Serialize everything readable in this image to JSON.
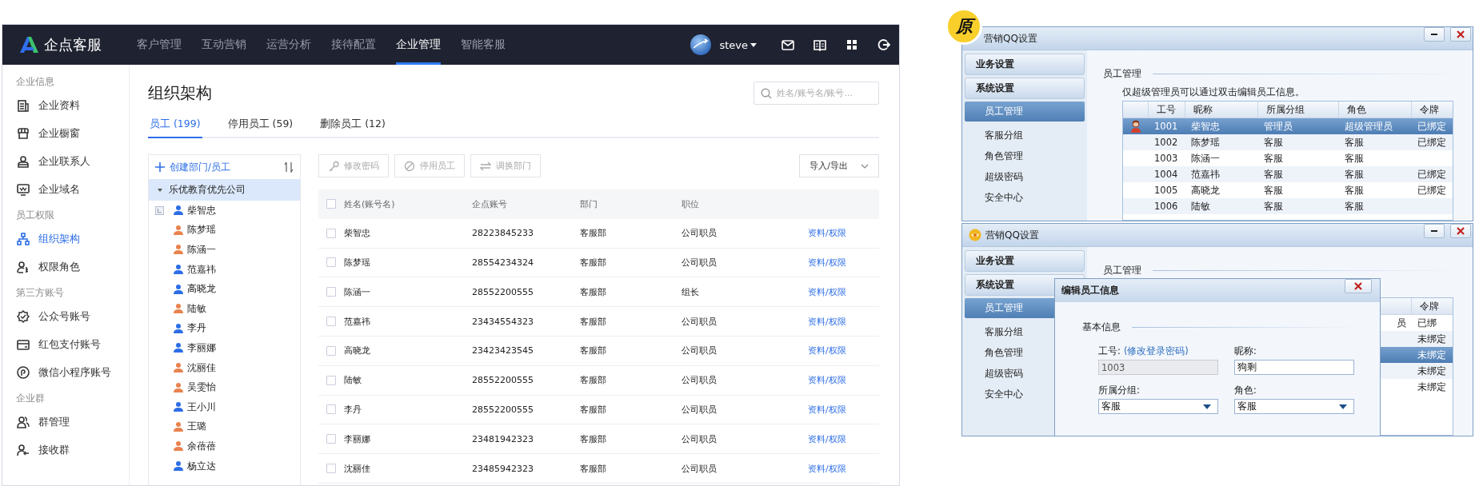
{
  "app": {
    "logo": "企点客服",
    "nav": [
      {
        "label": "客户管理",
        "selected": false
      },
      {
        "label": "互动营销",
        "selected": false
      },
      {
        "label": "运营分析",
        "selected": false
      },
      {
        "label": "接待配置",
        "selected": false
      },
      {
        "label": "企业管理",
        "selected": true
      },
      {
        "label": "智能客服",
        "selected": false
      }
    ],
    "user": "steve",
    "sidebar": [
      {
        "title": "企业信息",
        "items": [
          {
            "label": "企业资料",
            "selected": false
          },
          {
            "label": "企业橱窗",
            "selected": false
          },
          {
            "label": "企业联系人",
            "selected": false
          },
          {
            "label": "企业域名",
            "selected": false
          }
        ]
      },
      {
        "title": "员工权限",
        "items": [
          {
            "label": "组织架构",
            "selected": true
          },
          {
            "label": "权限角色",
            "selected": false
          }
        ]
      },
      {
        "title": "第三方账号",
        "items": [
          {
            "label": "公众号账号",
            "selected": false
          },
          {
            "label": "红包支付账号",
            "selected": false
          },
          {
            "label": "微信小程序账号",
            "selected": false
          }
        ]
      },
      {
        "title": "企业群",
        "items": [
          {
            "label": "群管理",
            "selected": false
          },
          {
            "label": "接收群",
            "selected": false
          }
        ]
      }
    ],
    "page_title": "组织架构",
    "search": {
      "placeholder": "姓名/账号名/账号..."
    },
    "tabs": [
      {
        "label": "员工 (199)",
        "selected": true
      },
      {
        "label": "停用员工 (59)",
        "selected": false
      },
      {
        "label": "删除员工 (12)",
        "selected": false
      }
    ],
    "tree": {
      "action": "创建部门/员工",
      "root": {
        "label": "乐优教育优先公司",
        "expanded": true,
        "selected": true,
        "children": [
          {
            "label": "柴智忠",
            "color": "#2d6ee6",
            "leader": true
          },
          {
            "label": "陈梦瑶",
            "color": "#e8834f",
            "leader": false
          },
          {
            "label": "陈涵一",
            "color": "#e8834f",
            "leader": false
          },
          {
            "label": "范嘉祎",
            "color": "#2d6ee6",
            "leader": false
          },
          {
            "label": "高晓龙",
            "color": "#2d6ee6",
            "leader": false
          },
          {
            "label": "陆敏",
            "color": "#e8834f",
            "leader": false
          },
          {
            "label": "李丹",
            "color": "#2d6ee6",
            "leader": false
          },
          {
            "label": "李丽娜",
            "color": "#2d6ee6",
            "leader": false
          },
          {
            "label": "沈丽佳",
            "color": "#e8834f",
            "leader": false
          },
          {
            "label": "吴雯怡",
            "color": "#e8834f",
            "leader": false
          },
          {
            "label": "王小川",
            "color": "#2d6ee6",
            "leader": false
          },
          {
            "label": "王璐",
            "color": "#e8834f",
            "leader": false
          },
          {
            "label": "余蓓蓓",
            "color": "#e8834f",
            "leader": false
          },
          {
            "label": "杨立达",
            "color": "#2d6ee6",
            "leader": false
          }
        ]
      }
    },
    "toolbar": [
      {
        "label": "修改密码",
        "disabled": true
      },
      {
        "label": "停用员工",
        "disabled": true
      },
      {
        "label": "调换部门",
        "disabled": true
      }
    ],
    "menu_button": "导入/导出",
    "table": {
      "all_checked": false,
      "columns": [
        "姓名(账号名)",
        "企点账号",
        "部门",
        "职位"
      ],
      "rows": [
        {
          "checked": false,
          "cells": [
            "柴智忠",
            "28223845233",
            "客服部",
            "公司职员"
          ],
          "action": "资料/权限"
        },
        {
          "checked": false,
          "cells": [
            "陈梦瑶",
            "28554234324",
            "客服部",
            "公司职员"
          ],
          "action": "资料/权限"
        },
        {
          "checked": false,
          "cells": [
            "陈涵一",
            "28552200555",
            "客服部",
            "组长"
          ],
          "action": "资料/权限"
        },
        {
          "checked": false,
          "cells": [
            "范嘉祎",
            "23434554323",
            "客服部",
            "公司职员"
          ],
          "action": "资料/权限"
        },
        {
          "checked": false,
          "cells": [
            "高晓龙",
            "23423423545",
            "客服部",
            "公司职员"
          ],
          "action": "资料/权限"
        },
        {
          "checked": false,
          "cells": [
            "陆敏",
            "28552200555",
            "客服部",
            "公司职员"
          ],
          "action": "资料/权限"
        },
        {
          "checked": false,
          "cells": [
            "李丹",
            "28552200555",
            "客服部",
            "公司职员"
          ],
          "action": "资料/权限"
        },
        {
          "checked": false,
          "cells": [
            "李丽娜",
            "23481942323",
            "客服部",
            "公司职员"
          ],
          "action": "资料/权限"
        },
        {
          "checked": false,
          "cells": [
            "沈丽佳",
            "23485942323",
            "客服部",
            "公司职员"
          ],
          "action": "资料/权限"
        }
      ]
    }
  },
  "badge": "原",
  "windows": [
    {
      "title": "营销QQ设置",
      "groups": [
        "业务设置",
        "系统设置"
      ],
      "items": [
        {
          "label": "员工管理",
          "selected": true
        },
        {
          "label": "客服分组",
          "selected": false
        },
        {
          "label": "角色管理",
          "selected": false
        },
        {
          "label": "超级密码",
          "selected": false
        },
        {
          "label": "安全中心",
          "selected": false
        }
      ],
      "section": "员工管理",
      "note": "仅超级管理员可以通过双击编辑员工信息。",
      "table": {
        "columns": [
          "工号",
          "昵称",
          "所属分组",
          "角色",
          "令牌"
        ],
        "rows": [
          {
            "selected": true,
            "avatar": true,
            "id": "1001",
            "nickname": "柴智忠",
            "group": "管理员",
            "role": "超级管理员",
            "token": "已绑定"
          },
          {
            "selected": false,
            "avatar": false,
            "id": "1002",
            "nickname": "陈梦瑶",
            "group": "客服",
            "role": "客服",
            "token": "已绑定"
          },
          {
            "selected": false,
            "avatar": false,
            "id": "1003",
            "nickname": "陈涵一",
            "group": "客服",
            "role": "客服"
          },
          {
            "selected": false,
            "avatar": false,
            "id": "1004",
            "nickname": "范嘉祎",
            "group": "客服",
            "role": "客服",
            "token": "已绑定"
          },
          {
            "selected": false,
            "avatar": false,
            "id": "1005",
            "nickname": "高晓龙",
            "group": "客服",
            "role": "客服",
            "token": "已绑定"
          },
          {
            "selected": false,
            "avatar": false,
            "id": "1006",
            "nickname": "陆敏",
            "group": "客服",
            "role": "客服"
          }
        ]
      }
    },
    {
      "title": "营销QQ设置",
      "groups": [
        "业务设置",
        "系统设置"
      ],
      "items": [
        {
          "label": "员工管理",
          "selected": true
        },
        {
          "label": "客服分组",
          "selected": false
        },
        {
          "label": "角色管理",
          "selected": false
        },
        {
          "label": "超级密码",
          "selected": false
        },
        {
          "label": "安全中心",
          "selected": false
        }
      ],
      "section": "员工管理",
      "table": {
        "columns": [
          "令牌"
        ],
        "rows": [
          {
            "selected": false,
            "role": "员",
            "token": "已绑"
          },
          {
            "selected": false,
            "token": "未绑定"
          },
          {
            "selected": true,
            "token": "未绑定"
          },
          {
            "selected": false,
            "token": "未绑定"
          },
          {
            "selected": false,
            "token": "未绑定"
          }
        ]
      },
      "dialog": {
        "title": "编辑员工信息",
        "section": "基本信息",
        "fields": [
          {
            "kind": "text",
            "label": "工号:",
            "link": "(修改登录密码)",
            "value": "1003",
            "disabled": true
          },
          {
            "kind": "text",
            "label": "昵称:",
            "value": "狗剩",
            "disabled": false
          },
          {
            "kind": "select",
            "label": "所属分组:",
            "value": "客服"
          },
          {
            "kind": "select",
            "label": "角色:",
            "value": "客服"
          }
        ]
      }
    }
  ]
}
